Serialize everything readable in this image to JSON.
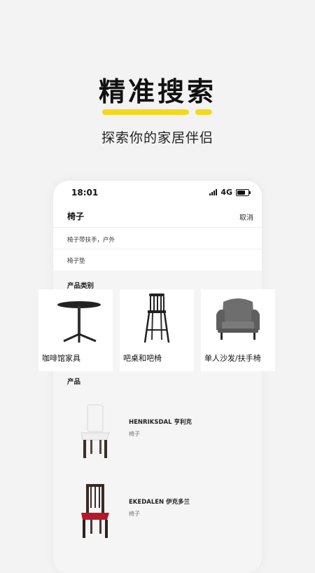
{
  "header": {
    "title": "精准搜索",
    "subtitle": "探索你的家居伴侣",
    "accent_color": "#f4d91b"
  },
  "status_bar": {
    "time": "18:01",
    "network": "4G"
  },
  "search": {
    "query": "椅子",
    "cancel_label": "取消",
    "suggestions": [
      "椅子带扶手，户外",
      "椅子垫"
    ]
  },
  "categories": {
    "title": "产品类别",
    "items": [
      {
        "label": "咖啡馆家具",
        "icon": "round-cafe-table-image"
      },
      {
        "label": "吧桌和吧椅",
        "icon": "bar-stool-image"
      },
      {
        "label": "单人沙发/扶手椅",
        "icon": "wingback-armchair-image"
      }
    ]
  },
  "products": {
    "title": "产品",
    "items": [
      {
        "name": "HENRIKSDAL 亨利克",
        "category": "椅子",
        "icon": "white-upholstered-chair-image"
      },
      {
        "name": "EKEDALEN 伊克多兰",
        "category": "椅子",
        "icon": "red-seat-dark-chair-image"
      }
    ]
  }
}
